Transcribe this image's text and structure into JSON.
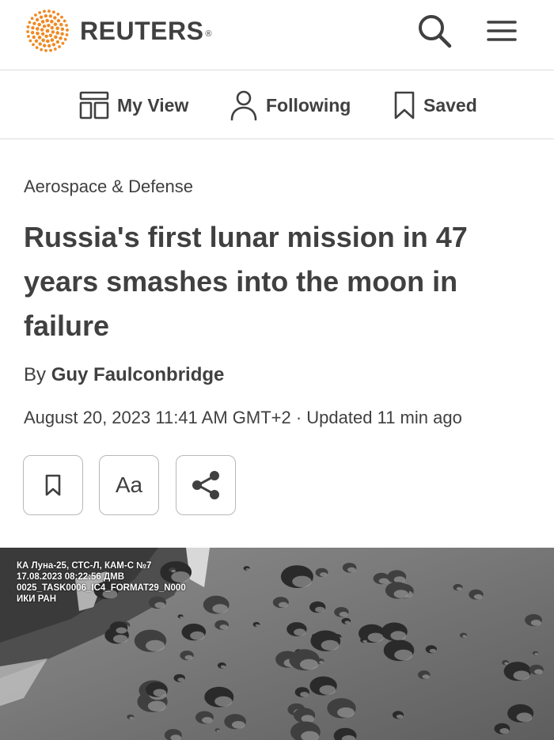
{
  "header": {
    "brand": "REUTERS",
    "brand_mark": "®",
    "search_icon": "search-icon",
    "menu_icon": "hamburger-menu-icon"
  },
  "subnav": {
    "items": [
      {
        "label": "My View",
        "icon": "my-view-icon"
      },
      {
        "label": "Following",
        "icon": "person-icon"
      },
      {
        "label": "Saved",
        "icon": "bookmark-icon"
      }
    ]
  },
  "article": {
    "category": "Aerospace & Defense",
    "headline": "Russia's first lunar mission in 47 years smashes into the moon in failure",
    "byline_prefix": "By",
    "author": "Guy Faulconbridge",
    "dateline": "August 20, 2023 11:41 AM GMT+2 · Updated 11 min ago"
  },
  "tools": {
    "bookmark_icon": "bookmark-icon",
    "text_size_label": "Aa",
    "share_icon": "share-icon"
  },
  "photo": {
    "caption_lines": [
      "КА Луна-25, СТС-Л, КАМ-С №7",
      "17.08.2023 08:22:56 ДМВ",
      "0025_TASK0006_IC4_FORMAT29_N000",
      "ИКИ РАН"
    ]
  },
  "colors": {
    "text": "#404040",
    "logo_orange": "#f08a24",
    "divider": "#dcdcdc"
  }
}
